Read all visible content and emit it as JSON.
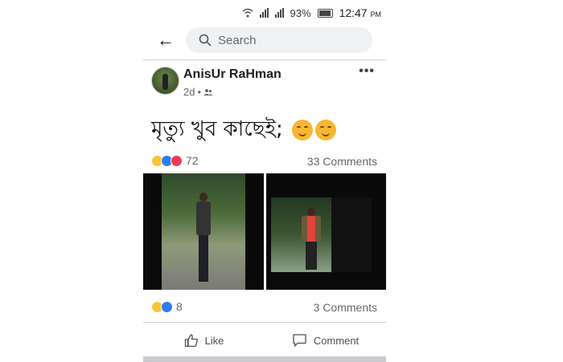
{
  "status_bar": {
    "battery": "93%",
    "time": "12:47",
    "ampm": "PM"
  },
  "search": {
    "placeholder": "Search"
  },
  "post": {
    "author": "AnisUr RaHman",
    "time_ago": "2d",
    "separator": "•",
    "text": "মৃত্যু খুব কাছেই;",
    "emoji_count": 2,
    "reaction_count": "72",
    "comments": "33 Comments"
  },
  "photo_post": {
    "reaction_count": "8",
    "comments": "3 Comments"
  },
  "actions": {
    "like": "Like",
    "comment": "Comment"
  },
  "icons": [
    "wifi-icon",
    "signal-icon",
    "battery-icon",
    "back-arrow-icon",
    "search-icon",
    "more-options-icon",
    "friends-audience-icon",
    "like-icon",
    "comment-icon"
  ]
}
